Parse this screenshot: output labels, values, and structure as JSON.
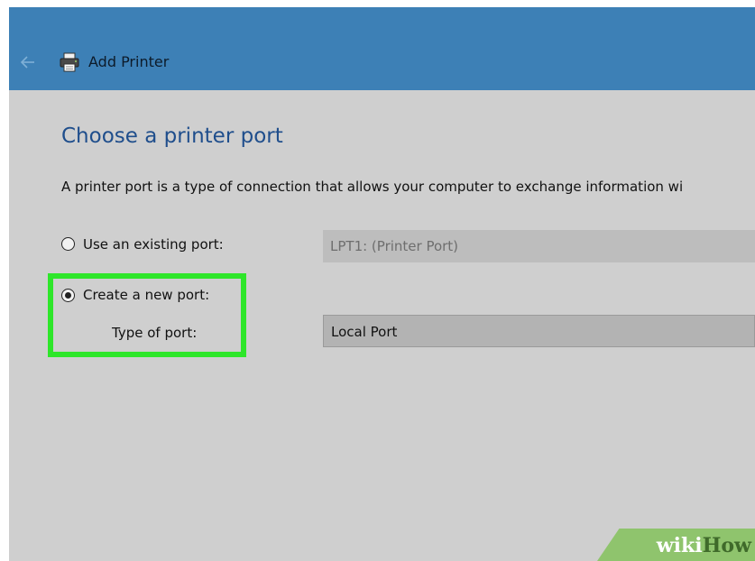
{
  "window": {
    "title": "Add Printer",
    "back_icon": "back-arrow-icon",
    "app_icon": "printer-icon",
    "accent": "#3d80b6"
  },
  "page": {
    "title": "Choose a printer port",
    "description": "A printer port is a type of connection that allows your computer to exchange information wi"
  },
  "options": {
    "existing_port": {
      "label": "Use an existing port:",
      "selected": false,
      "value": "LPT1: (Printer Port)",
      "enabled": false
    },
    "new_port": {
      "label": "Create a new port:",
      "selected": true,
      "type_label": "Type of port:",
      "value": "Local Port",
      "enabled": true
    }
  },
  "highlight_color": "#2ee62a",
  "watermark": {
    "part1": "wiki",
    "part2": "How",
    "color": "#8fc46d"
  }
}
